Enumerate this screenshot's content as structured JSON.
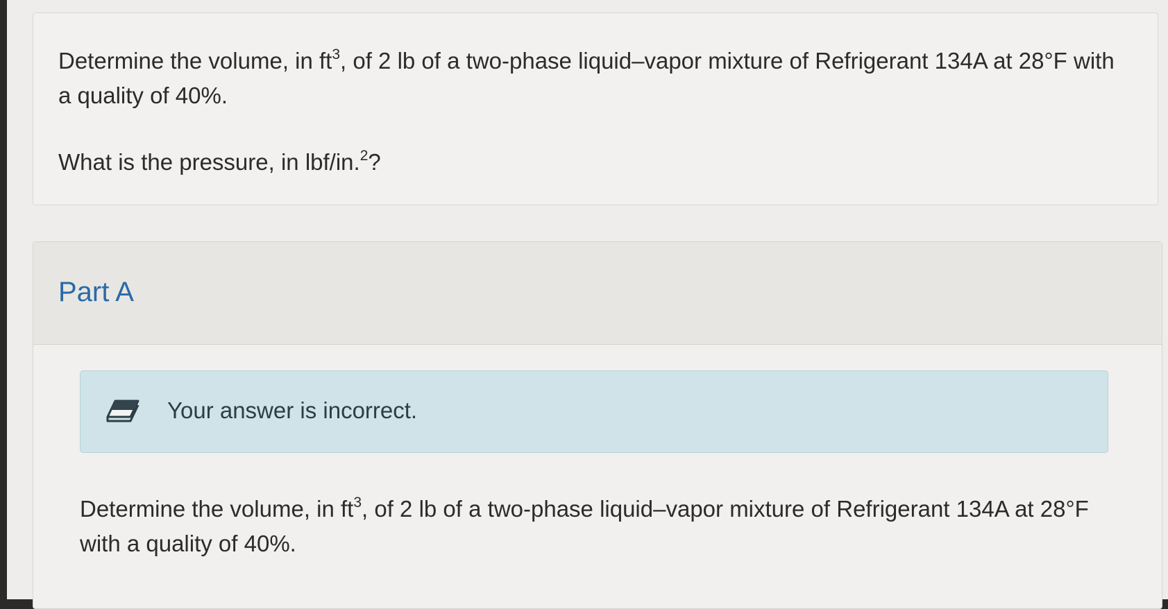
{
  "question": {
    "line1_before_sup": "Determine the volume, in ft",
    "line1_sup": "3",
    "line1_after_sup": ", of 2 lb of a two-phase liquid–vapor mixture of Refrigerant 134A at 28°F with a quality of 40%.",
    "sub_before_sup": "What is the pressure, in lbf/in.",
    "sub_sup": "2",
    "sub_after_sup": "?"
  },
  "part_a": {
    "title": "Part A",
    "feedback": {
      "icon": "eraser-icon",
      "text": "Your answer is incorrect."
    },
    "prompt_before_sup": "Determine the volume, in ft",
    "prompt_sup": "3",
    "prompt_after_sup": ", of 2 lb of a two-phase liquid–vapor mixture of Refrigerant 134A at 28°F with a quality of 40%."
  },
  "colors": {
    "part_title": "#2a6aa6",
    "feedback_background": "#cfe3e8"
  }
}
